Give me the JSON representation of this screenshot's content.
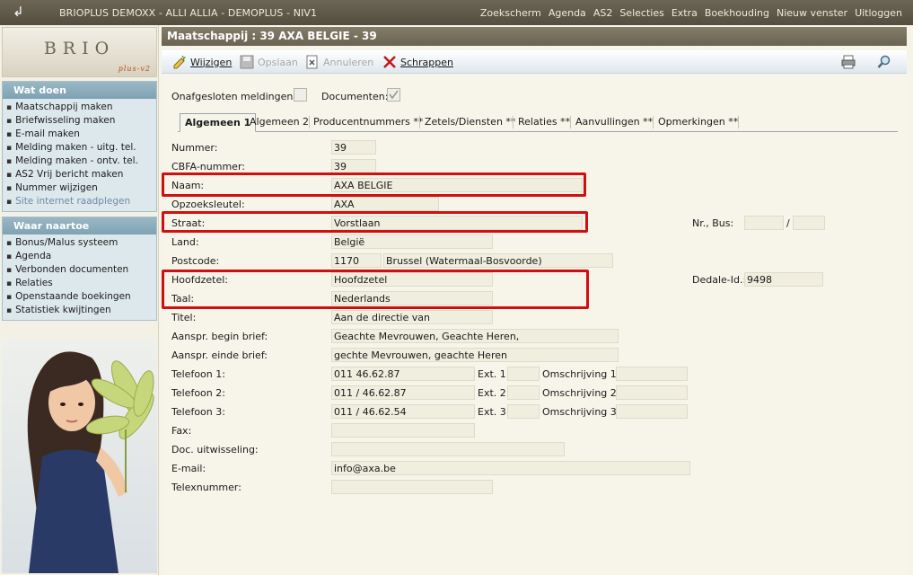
{
  "app": {
    "title": "BRIOPLUS DEMOXX - ALLI ALLIA - DEMOPLUS - NIV1",
    "menu": [
      "Zoekscherm",
      "Agenda",
      "AS2",
      "Selecties",
      "Extra",
      "Boekhouding",
      "Nieuw venster",
      "Uitloggen"
    ]
  },
  "logo": {
    "name": "BRIO",
    "sub": "plus-v2"
  },
  "sidebar": {
    "wat_doen": {
      "title": "Wat doen",
      "items": [
        "Maatschappij maken",
        "Briefwisseling maken",
        "E-mail maken",
        "Melding maken - uitg. tel.",
        "Melding maken - ontv. tel.",
        "AS2 Vrij bericht maken",
        "Nummer wijzigen",
        "Site internet raadplegen"
      ]
    },
    "waar_naartoe": {
      "title": "Waar naartoe",
      "items": [
        "Bonus/Malus systeem",
        "Agenda",
        "Verbonden documenten",
        "Relaties",
        "Openstaande boekingen",
        "Statistiek kwijtingen"
      ]
    }
  },
  "page": {
    "title": "Maatschappij : 39 AXA BELGIE  - 39"
  },
  "toolbar": {
    "edit": "Wijzigen",
    "save": "Opslaan",
    "cancel": "Annuleren",
    "delete": "Schrappen"
  },
  "options": {
    "open_reports_label": "Onafgesloten meldingen:",
    "documents_label": "Documenten:"
  },
  "tabs": [
    "Algemeen 1",
    "Algemeen 2",
    "Producentnummers **",
    "Zetels/Diensten **",
    "Relaties **",
    "Aanvullingen **",
    "Opmerkingen **"
  ],
  "form": {
    "nummer": {
      "label": "Nummer:",
      "value": "39"
    },
    "cbfa": {
      "label": "CBFA-nummer:",
      "value": "39"
    },
    "naam": {
      "label": "Naam:",
      "value": "AXA BELGIE"
    },
    "opzoek": {
      "label": "Opzoeksleutel:",
      "value": "AXA"
    },
    "straat": {
      "label": "Straat:",
      "value": "Vorstlaan"
    },
    "nrbus": {
      "label": "Nr., Bus:",
      "nr": "",
      "sep": "/",
      "bus": ""
    },
    "land": {
      "label": "Land:",
      "value": "België"
    },
    "postcode": {
      "label": "Postcode:",
      "value": "1170",
      "city": "Brussel (Watermaal-Bosvoorde)"
    },
    "hoofdzetel": {
      "label": "Hoofdzetel:",
      "value": "Hoofdzetel"
    },
    "dedale": {
      "label": "Dedale-Id.:",
      "value": "9498"
    },
    "taal": {
      "label": "Taal:",
      "value": "Nederlands"
    },
    "titel": {
      "label": "Titel:",
      "value": "Aan de directie van"
    },
    "aanspr_begin": {
      "label": "Aanspr. begin brief:",
      "value": "Geachte Mevrouwen, Geachte Heren,"
    },
    "aanspr_einde": {
      "label": "Aanspr. einde brief:",
      "value": "gechte Mevrouwen, geachte Heren"
    },
    "tel1": {
      "label": "Telefoon 1:",
      "value": "011 46.62.87",
      "ext_label": "Ext. 1:",
      "ext": "",
      "omschr_label": "Omschrijving 1:",
      "omschr": ""
    },
    "tel2": {
      "label": "Telefoon 2:",
      "value": "011 / 46.62.87",
      "ext_label": "Ext. 2:",
      "ext": "",
      "omschr_label": "Omschrijving 2:",
      "omschr": ""
    },
    "tel3": {
      "label": "Telefoon 3:",
      "value": "011 / 46.62.54",
      "ext_label": "Ext. 3:",
      "ext": "",
      "omschr_label": "Omschrijving 3:",
      "omschr": ""
    },
    "fax": {
      "label": "Fax:",
      "value": ""
    },
    "doc": {
      "label": "Doc. uitwisseling:",
      "value": ""
    },
    "email": {
      "label": "E-mail:",
      "value": "info@axa.be"
    },
    "telex": {
      "label": "Telexnummer:",
      "value": ""
    }
  },
  "colors": {
    "highlight": "#d01010",
    "topbar": "#5e5848",
    "panel_header": "#8aabba"
  }
}
